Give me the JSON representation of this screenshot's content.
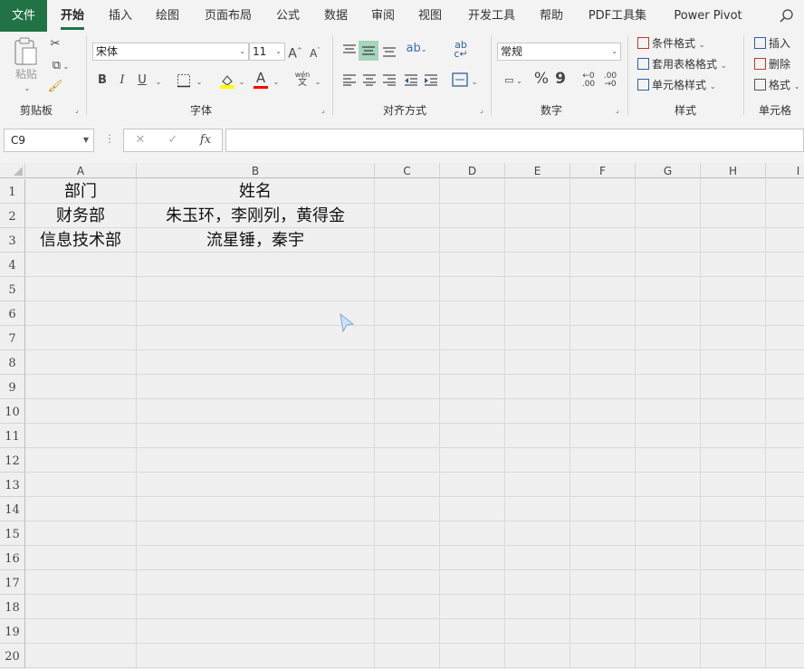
{
  "tabs": [
    "文件",
    "开始",
    "插入",
    "绘图",
    "页面布局",
    "公式",
    "数据",
    "审阅",
    "视图",
    "开发工具",
    "帮助",
    "PDF工具集",
    "Power Pivot"
  ],
  "icons": {
    "search": "search-icon"
  },
  "ribbon": {
    "clipboard": {
      "paste_label": "粘贴",
      "group_label": "剪贴板"
    },
    "font": {
      "font_name": "宋体",
      "font_size": "11",
      "bold": "B",
      "italic": "I",
      "underline": "U",
      "font_color_glyph": "A",
      "grow_glyph": "A^",
      "shrink_glyph": "Aˇ",
      "phonetic_glyph": "wén",
      "group_label": "字体",
      "highlight_color": "#ffff00",
      "text_color": "#ff0000"
    },
    "alignment": {
      "group_label": "对齐方式"
    },
    "number": {
      "format": "常规",
      "percent": "%",
      "comma": "9",
      "group_label": "数字"
    },
    "styles": {
      "cond_format": "条件格式",
      "table_format": "套用表格格式",
      "cell_styles": "单元格样式",
      "group_label": "样式"
    },
    "cells": {
      "insert": "插入",
      "delete": "删除",
      "format": "格式",
      "group_label": "单元格"
    }
  },
  "formula_bar": {
    "name_box": "C9",
    "cancel": "✕",
    "enter": "✓",
    "fx": "fx",
    "content": ""
  },
  "columns": [
    "A",
    "B",
    "C",
    "D",
    "E",
    "F",
    "G",
    "H",
    "I"
  ],
  "rows": [
    "1",
    "2",
    "3",
    "4",
    "5",
    "6",
    "7",
    "8",
    "9",
    "10",
    "11",
    "12",
    "13",
    "14",
    "15",
    "16",
    "17",
    "18",
    "19",
    "20"
  ],
  "cells": {
    "A1": "部门",
    "B1": "姓名",
    "A2": "财务部",
    "B2": "朱玉环，李刚列，黄得金",
    "A3": "信息技术部",
    "B3": "流星锤，秦宇"
  },
  "colors": {
    "accent": "#217346",
    "grid": "#dadada"
  }
}
